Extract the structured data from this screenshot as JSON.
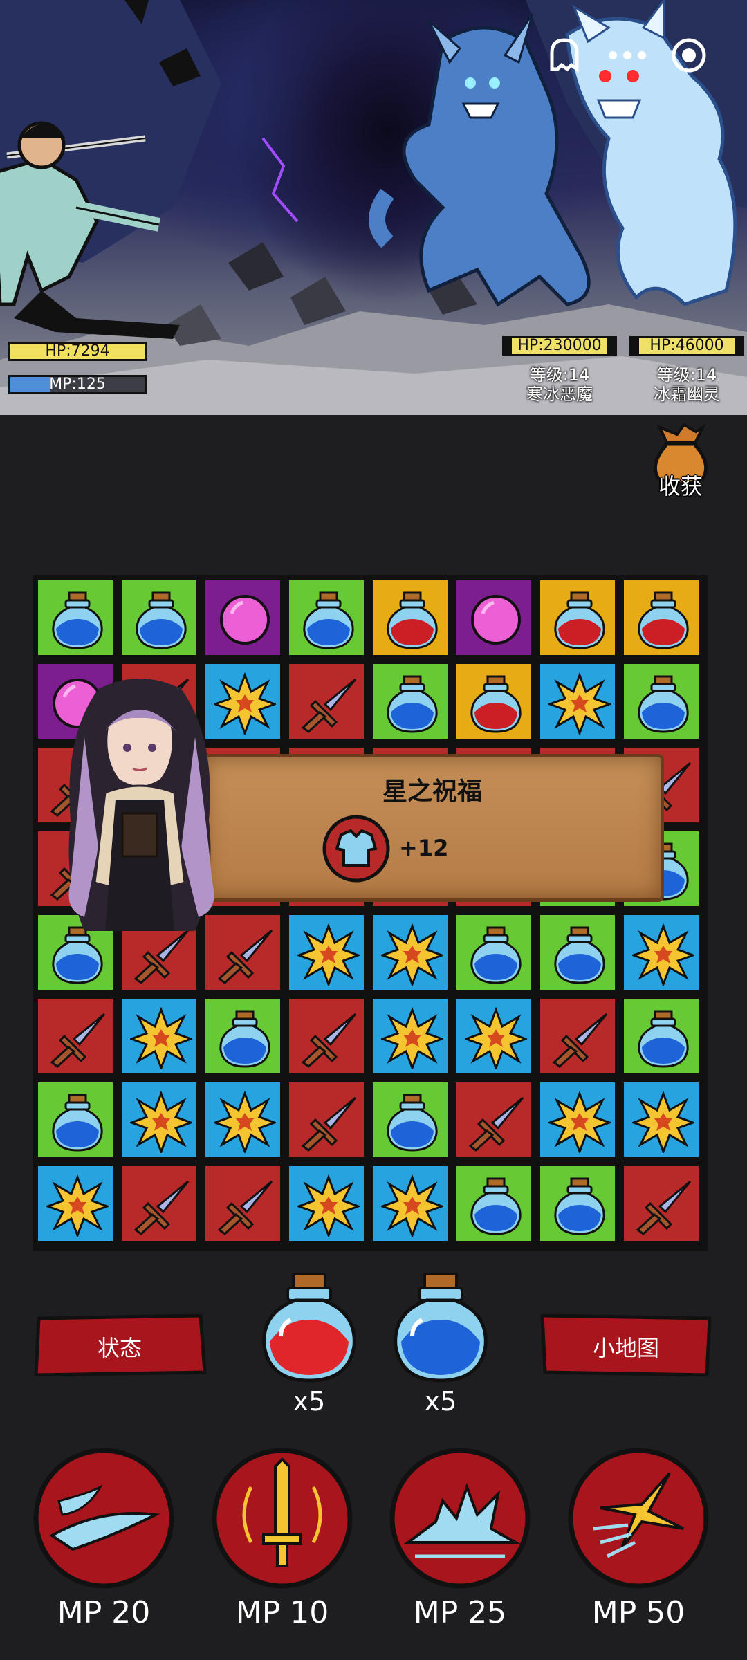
{
  "scene": {
    "player": {
      "hp_label": "HP:7294",
      "mp_label": "MP:125",
      "mp_fill": 0.3
    },
    "enemies": [
      {
        "hp_label": "HP:230000",
        "level": "等级:14",
        "name": "寒冰恶魔"
      },
      {
        "hp_label": "HP:46000",
        "level": "等级:14",
        "name": "冰霜幽灵"
      }
    ],
    "top_icons": [
      "ghost-icon",
      "more-icon",
      "record-icon"
    ]
  },
  "harvest": {
    "label": "收获",
    "icon": "money-bag-icon"
  },
  "board": {
    "rows": [
      [
        "blue-potion:green",
        "blue-potion:green",
        "pink-orb:purple",
        "blue-potion:green",
        "red-potion:yellow",
        "pink-orb:purple",
        "red-potion:yellow",
        "red-potion:yellow"
      ],
      [
        "pink-orb:purple",
        "sword:red",
        "burst:blue",
        "sword:red",
        "blue-potion:green",
        "red-potion:yellow",
        "burst:blue",
        "blue-potion:green"
      ],
      [
        "sword:red",
        "sword:red",
        "sword:red",
        "sword:red",
        "sword:red",
        "sword:red",
        "sword:red",
        "sword:red"
      ],
      [
        "sword:red",
        "sword:red",
        "sword:red",
        "sword:red",
        "sword:red",
        "sword:red",
        "blue-potion:green",
        "blue-potion:green"
      ],
      [
        "blue-potion:green",
        "sword:red",
        "sword:red",
        "burst:blue",
        "burst:blue",
        "blue-potion:green",
        "blue-potion:green",
        "burst:blue"
      ],
      [
        "sword:red",
        "burst:blue",
        "blue-potion:green",
        "sword:red",
        "burst:blue",
        "burst:blue",
        "sword:red",
        "blue-potion:green"
      ],
      [
        "blue-potion:green",
        "burst:blue",
        "burst:blue",
        "sword:red",
        "blue-potion:green",
        "sword:red",
        "burst:blue",
        "burst:blue"
      ],
      [
        "burst:blue",
        "sword:red",
        "sword:red",
        "burst:blue",
        "burst:blue",
        "blue-potion:green",
        "blue-potion:green",
        "sword:red"
      ]
    ]
  },
  "popup": {
    "title": "星之祝福",
    "bonus": "+12",
    "icon": "armor-shirt-icon"
  },
  "controls": {
    "status_label": "状态",
    "minimap_label": "小地图",
    "red_potion_count": "x5",
    "blue_potion_count": "x5"
  },
  "skills": [
    {
      "icon": "wind-slash-icon",
      "cost": "MP 20"
    },
    {
      "icon": "sword-aura-icon",
      "cost": "MP 10"
    },
    {
      "icon": "wave-icon",
      "cost": "MP 25"
    },
    {
      "icon": "comet-icon",
      "cost": "MP 50"
    }
  ],
  "colors": {
    "background": "#1e1e21",
    "tile_green": "#67c933",
    "tile_blue": "#27a3e0",
    "tile_red": "#b82a2a",
    "tile_yellow": "#e7ac13",
    "tile_purple": "#7d1e8f",
    "hp_bar": "#f2e160",
    "mp_bar": "#4f8fd8",
    "button_red": "#a8151c"
  }
}
